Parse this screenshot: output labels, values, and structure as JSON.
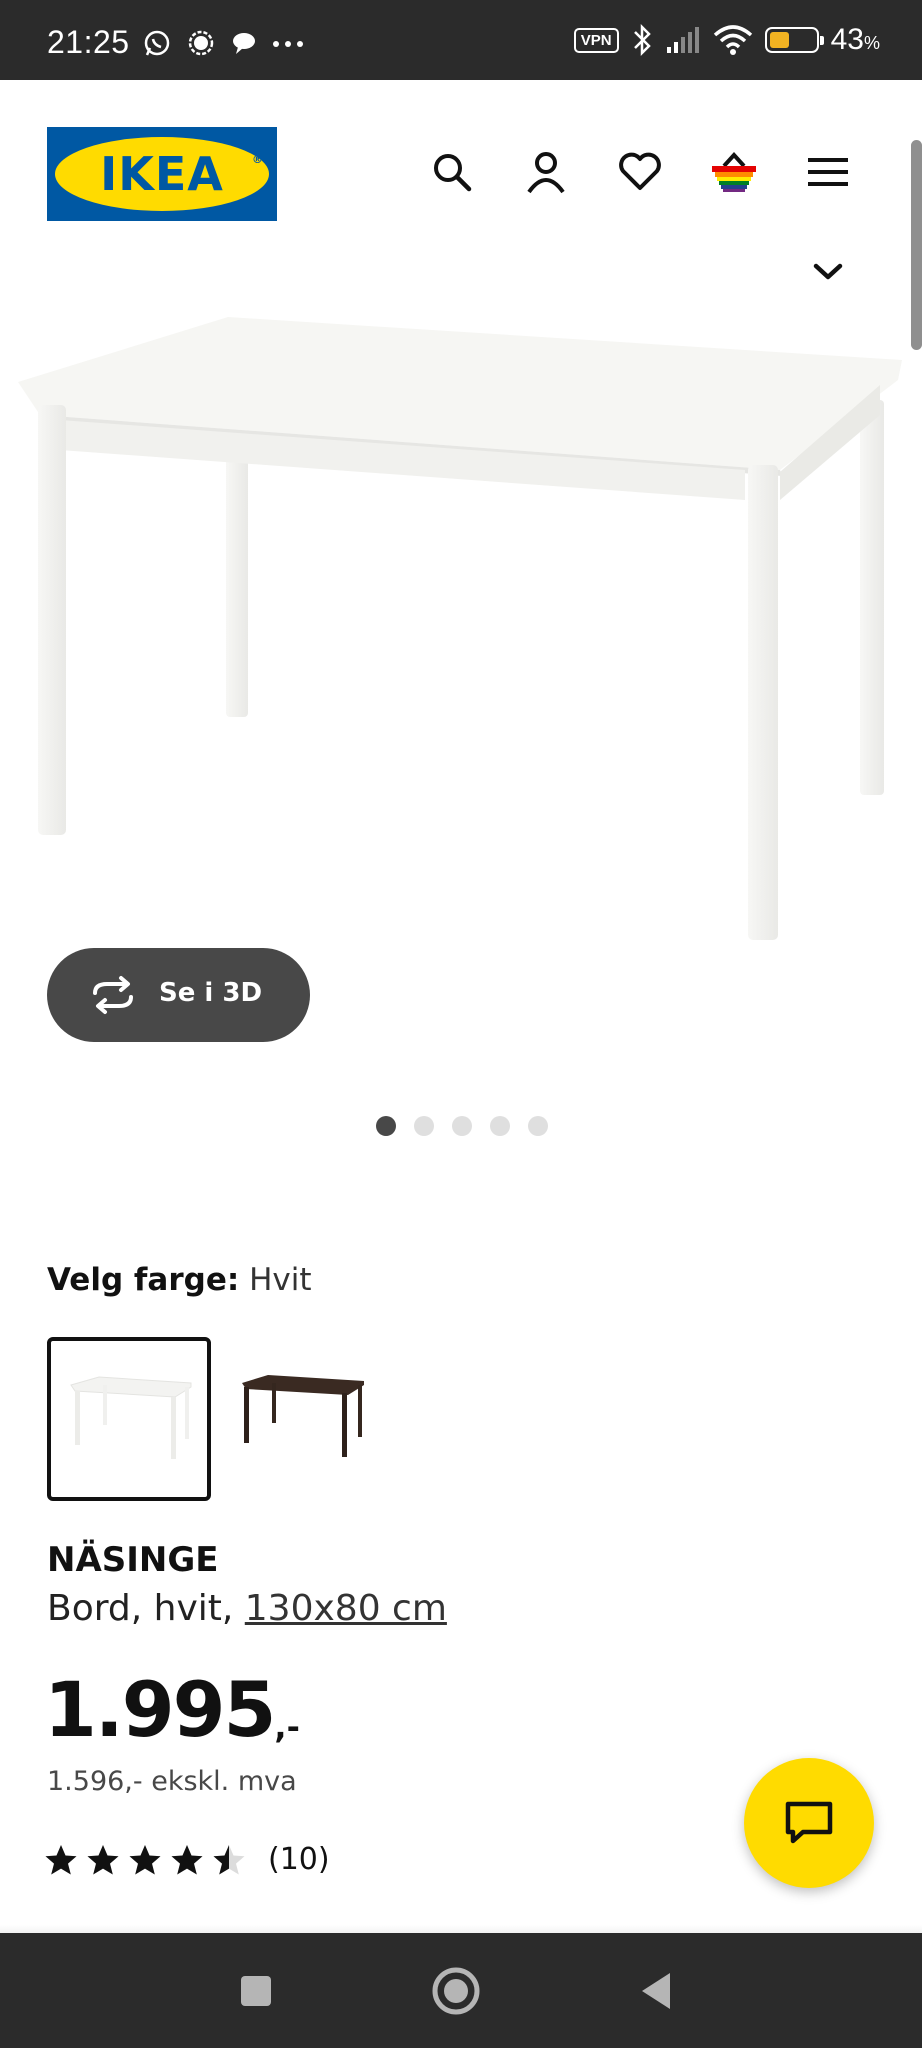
{
  "status_bar": {
    "time": "21:25",
    "vpn_label": "VPN",
    "battery_percent": "43",
    "battery_unit": "%",
    "battery_level": 0.43,
    "icons": [
      "whatsapp-icon",
      "signal-app-icon",
      "chat-bubble-icon",
      "more-dots-icon",
      "bluetooth-icon",
      "cellular-signal-icon",
      "wifi-icon",
      "battery-icon"
    ]
  },
  "header": {
    "logo_text": "IKEA",
    "logo_reg": "®",
    "icons": [
      "search-icon",
      "account-icon",
      "heart-icon",
      "basket-icon",
      "menu-icon"
    ]
  },
  "gallery": {
    "view_3d_label": "Se i 3D",
    "image_count": 5,
    "active_index": 0
  },
  "color_selector": {
    "label": "Velg farge:",
    "selected_value": "Hvit",
    "options": [
      {
        "name": "Hvit",
        "color": "#f4f4f2",
        "selected": true
      },
      {
        "name": "Mørk",
        "color": "#3a2a22",
        "selected": false
      }
    ]
  },
  "product": {
    "name": "NÄSINGE",
    "description_prefix": "Bord, hvit, ",
    "size": "130x80 cm",
    "price": "1.995",
    "price_suffix": ",-",
    "price_ex_vat": "1.596,- ekskl. mva",
    "rating_value": 4.5,
    "rating_max": 5,
    "review_count": "(10)"
  },
  "colors": {
    "ikea_blue": "#0058a3",
    "ikea_yellow": "#ffdb00",
    "dark_button": "#484848",
    "system_bar": "#2b2b2b"
  }
}
